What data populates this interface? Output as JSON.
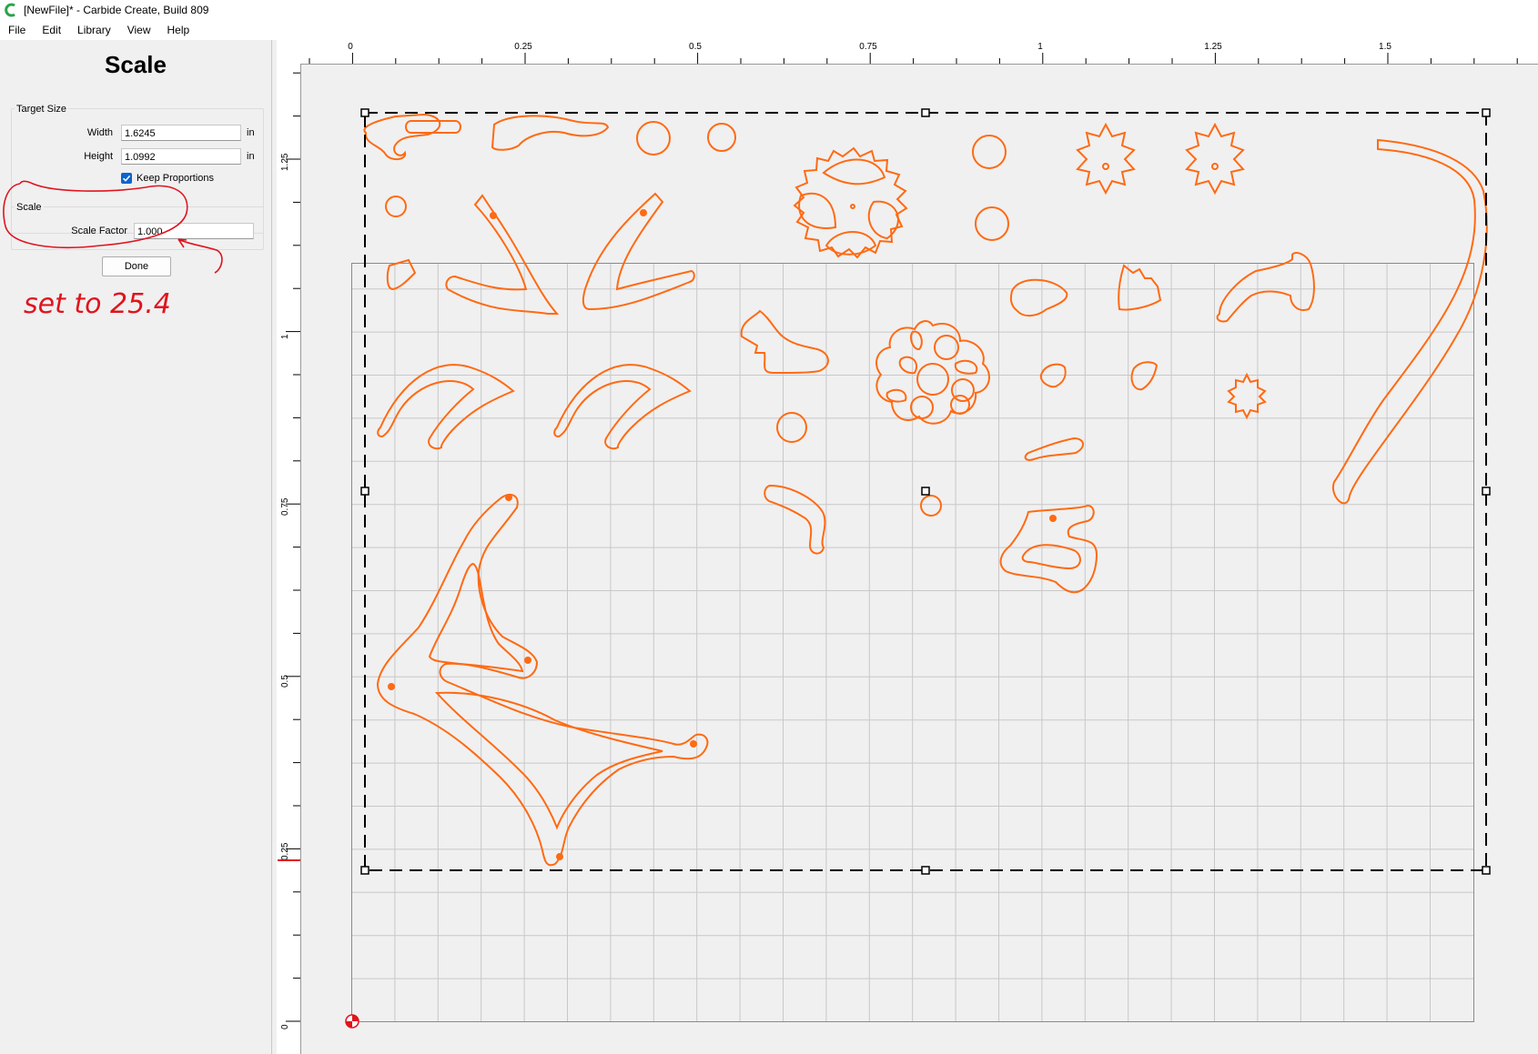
{
  "window": {
    "title": "[NewFile]* - Carbide Create, Build 809",
    "icon": "carbide-c-icon"
  },
  "menu": [
    "File",
    "Edit",
    "Library",
    "View",
    "Help"
  ],
  "panel": {
    "title": "Scale",
    "target_size": {
      "label": "Target Size",
      "width_label": "Width",
      "width_value": "1.6245",
      "width_unit": "in",
      "height_label": "Height",
      "height_value": "1.0992",
      "height_unit": "in",
      "keep_proportions_label": "Keep Proportions",
      "keep_proportions_checked": true
    },
    "scale": {
      "label": "Scale",
      "factor_label": "Scale Factor",
      "factor_value": "1.000"
    },
    "done_label": "Done",
    "annotation": "set to 25.4"
  },
  "ruler": {
    "top_labels": [
      "0",
      "0.25",
      "0.5",
      "0.75",
      "1",
      "1.25",
      "1.5"
    ],
    "left_labels": [
      "1.25",
      "1",
      "0.75",
      "0.5",
      "0.25",
      "0"
    ]
  },
  "colors": {
    "vector": "#ff6a13",
    "annotation": "#e0141e",
    "grid": "#c8c8c8",
    "checkbox": "#0a64d0"
  }
}
